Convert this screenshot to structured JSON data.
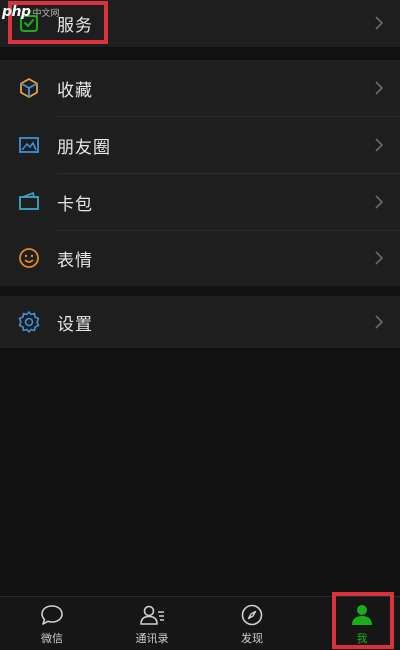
{
  "watermark": {
    "logo": "php",
    "chinese": "中文网"
  },
  "service": {
    "label": "服务"
  },
  "menu": {
    "favorites": "收藏",
    "moments": "朋友圈",
    "cards": "卡包",
    "stickers": "表情",
    "settings": "设置"
  },
  "tabbar": {
    "chats": "微信",
    "contacts": "通讯录",
    "discover": "发现",
    "me": "我"
  },
  "colors": {
    "accent": "#1aad19",
    "highlight_box": "#d8323d",
    "background": "#111111",
    "cell": "#1e1e1e"
  }
}
